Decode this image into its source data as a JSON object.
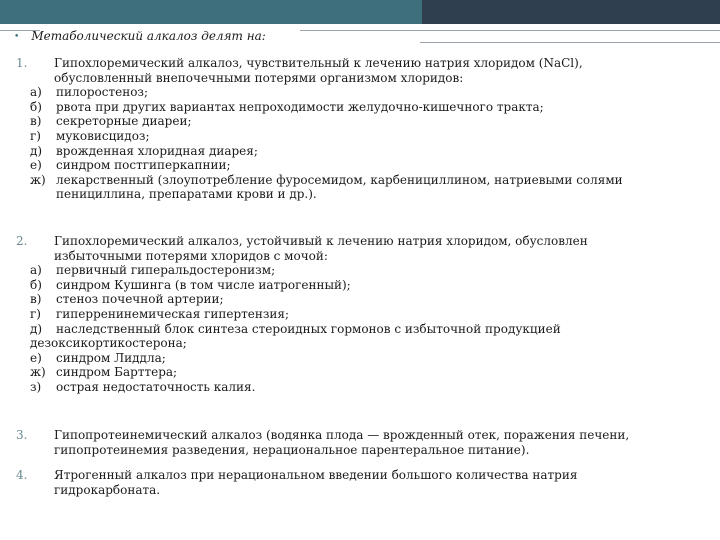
{
  "heading": "Метаболический алкалоз делят на:",
  "items": [
    {
      "num": "1.",
      "lines": [
        "Гипохлоремический алкалоз, чувствительный к лечению натрия хлоридом (NaCl),",
        "обусловленный внепочечными потерями организмом хлоридов:"
      ],
      "subs": [
        {
          "mark": "а)",
          "text": "пилоростеноз;"
        },
        {
          "mark": "б)",
          "text": "рвота при других вариантах непроходимости желудочно-кишечного тракта;"
        },
        {
          "mark": "в)",
          "text": "секреторные диареи;"
        },
        {
          "mark": "г)",
          "text": "муковисцидоз;"
        },
        {
          "mark": "д)",
          "text": "врожденная хлоридная диарея;"
        },
        {
          "mark": "е)",
          "text": "синдром постгиперкапнии;"
        },
        {
          "mark": "ж)",
          "text": "лекарственный (злоупотребление фуросемидом, карбенициллином, натриевыми солями"
        }
      ],
      "tail": "пенициллина, препаратами крови и др.)."
    },
    {
      "num": "2.",
      "lines": [
        "Гипохлоремический алкалоз, устойчивый к лечению натрия хлоридом, обусловлен",
        "избыточными потерями хлоридов с мочой:"
      ],
      "subs": [
        {
          "mark": "а)",
          "text": "первичный гиперальдостеронизм;"
        },
        {
          "mark": "б)",
          "text": "синдром Кушинга (в том числе иатрогенный);"
        },
        {
          "mark": "в)",
          "text": "стеноз почечной артерии;"
        },
        {
          "mark": "г)",
          "text": "гиперренинемическая гипертензия;"
        },
        {
          "mark": "д)",
          "text": "наследственный блок синтеза стероидных гормонов с избыточной продукцией"
        }
      ],
      "tail": "дезоксикортикостерона;",
      "subs2": [
        {
          "mark": "е)",
          "text": "синдром Лиддла;"
        },
        {
          "mark": "ж)",
          "text": "синдром Барттера;"
        },
        {
          "mark": "з)",
          "text": "острая недостаточность калия."
        }
      ]
    },
    {
      "num": "3.",
      "lines": [
        "Гипопротеинемический алкалоз (водянка плода — врожденный отек, поражения печени,",
        "гипопротеинемия разведения, нерациональное парентеральное питание)."
      ]
    },
    {
      "num": "4.",
      "lines": [
        "Ятрогенный алкалоз при нерациональном введении большого количества натрия",
        "гидрокарбоната."
      ]
    }
  ]
}
